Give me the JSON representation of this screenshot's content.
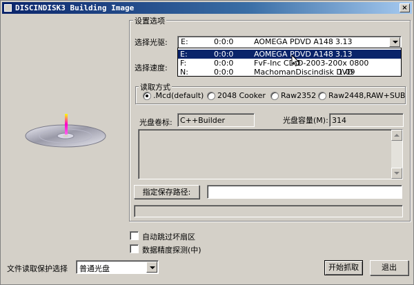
{
  "window": {
    "title": "DISCINDISK3 Building Image",
    "close": "×"
  },
  "settings_group": {
    "label": "设置选项"
  },
  "drive": {
    "label": "选择光驱:",
    "selected": {
      "letter": "E:",
      "addr": "0:0:0",
      "name": "AOMEGA  PDVD A148",
      "ver": "3.13"
    },
    "options": [
      {
        "letter": "E:",
        "addr": "0:0:0",
        "name": "AOMEGA  PDVD A148",
        "ver": "3.13"
      },
      {
        "letter": "F:",
        "addr": "0:0:0",
        "name": "FvF-Inc CDD",
        "ver": "D-2003-200x 0800"
      },
      {
        "letter": "N:",
        "addr": "0:0:0",
        "name": "MachomanDiscindisk DVD",
        "ver": "1.09"
      }
    ]
  },
  "speed": {
    "label": "选择速度:"
  },
  "read_mode": {
    "label": "读取方式",
    "options": [
      ".Mcd(default)",
      "2048 Cooker",
      "Raw2352",
      "Raw2448,RAW+SUB"
    ],
    "selected_index": 0
  },
  "volume": {
    "label": "光盘卷标:",
    "value": "C++Builder"
  },
  "capacity": {
    "label": "光盘容量(M):",
    "value": "314"
  },
  "save_path": {
    "button": "指定保存路径:",
    "value": ""
  },
  "options": {
    "skip_bad": "自动跳过坏扇区",
    "precision_detect": "数据精度探测(中)"
  },
  "protect": {
    "label": "文件读取保护选择",
    "value": "普通光盘"
  },
  "buttons": {
    "start": "开始抓取",
    "exit": "退出"
  },
  "colors": {
    "titlebar": "#0a246a",
    "face": "#d4d0c8",
    "highlight": "#0a246a"
  }
}
